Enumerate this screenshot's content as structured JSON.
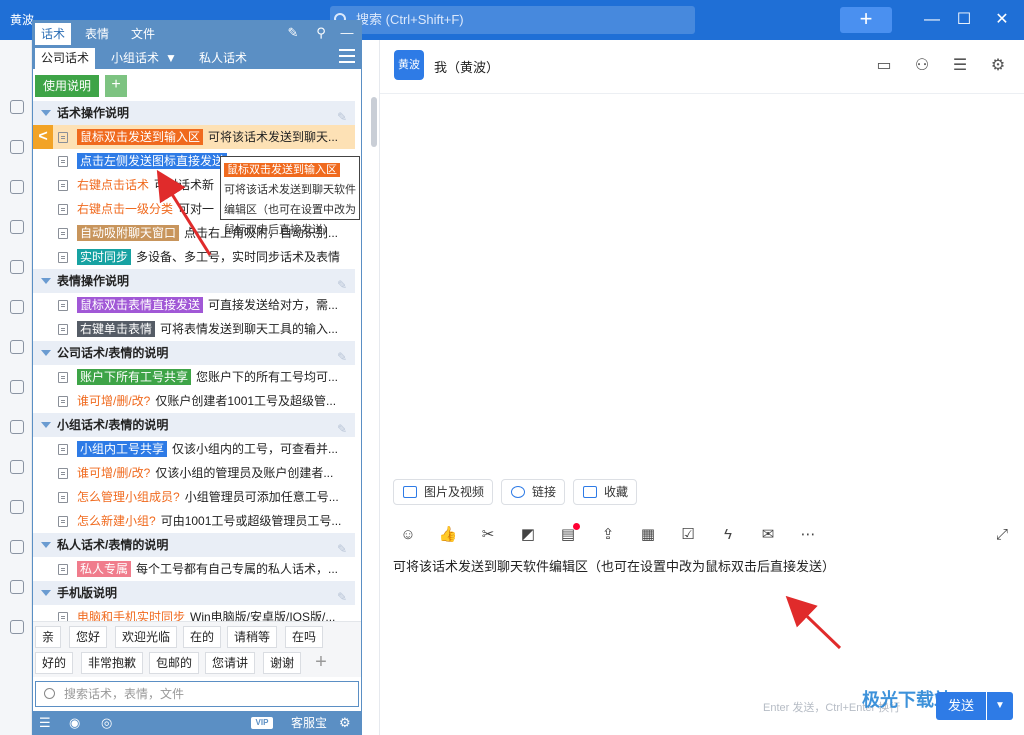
{
  "topbar": {
    "app_badge": "黄波",
    "search_placeholder": "搜索 (Ctrl+Shift+F)",
    "new_label": "+",
    "minimize": "—",
    "maximize": "☐",
    "close": "✕"
  },
  "panel": {
    "tabs": [
      "话术",
      "表情",
      "文件"
    ],
    "subtabs": [
      "公司话术",
      "小组话术",
      "私人话术"
    ],
    "usage_button": "使用说明",
    "add_button": "+",
    "groups": [
      {
        "title": "话术操作说明",
        "rows": [
          {
            "tag": "鼠标双击发送到输入区",
            "color": "#f06a1e",
            "desc": "可将该话术发送到聊天..."
          },
          {
            "tag": "点击左侧发送图标直接发送",
            "color": "#2e7be6",
            "desc": ""
          },
          {
            "tag": "右键点击话术",
            "color": "",
            "desc": "可对话术新"
          },
          {
            "tag": "右键点击一级分类",
            "color": "",
            "desc": "可对一"
          },
          {
            "tag": "自动吸附聊天窗口",
            "color": "#c8955c",
            "desc": "点击右上角吸附，自动识别..."
          },
          {
            "tag": "实时同步",
            "color": "#17a2a2",
            "desc": "多设备、多工号，实时同步话术及表情"
          }
        ]
      },
      {
        "title": "表情操作说明",
        "rows": [
          {
            "tag": "鼠标双击表情直接发送",
            "color": "#a158d6",
            "desc": "可直接发送给对方，需..."
          },
          {
            "tag": "右键单击表情",
            "color": "#555c66",
            "desc": "可将表情发送到聊天工具的输入..."
          }
        ]
      },
      {
        "title": "公司话术/表情的说明",
        "rows": [
          {
            "tag": "账户下所有工号共享",
            "color": "#3ea447",
            "desc": "您账户下的所有工号均可..."
          },
          {
            "tag": "谁可增/删/改?",
            "color": "",
            "desc": "仅账户创建者1001工号及超级管..."
          }
        ]
      },
      {
        "title": "小组话术/表情的说明",
        "rows": [
          {
            "tag": "小组内工号共享",
            "color": "#2e7be6",
            "desc": "仅该小组内的工号，可查看并..."
          },
          {
            "tag": "谁可增/删/改?",
            "color": "",
            "desc": "仅该小组的管理员及账户创建者..."
          },
          {
            "tag": "怎么管理小组成员?",
            "color": "",
            "desc": "小组管理员可添加任意工号..."
          },
          {
            "tag": "怎么新建小组?",
            "color": "",
            "desc": "可由1001工号或超级管理员工号..."
          }
        ]
      },
      {
        "title": "私人话术/表情的说明",
        "rows": [
          {
            "tag": "私人专属",
            "color": "#f07c8c",
            "desc": "每个工号都有自己专属的私人话术，..."
          }
        ]
      },
      {
        "title": "手机版说明",
        "rows": [
          {
            "tag": "电脑和手机实时同步",
            "color": "",
            "desc": "Win电脑版/安卓版/IOS版/..."
          }
        ]
      }
    ],
    "phrases_row1": [
      "亲",
      "您好",
      "欢迎光临",
      "在的",
      "请稍等",
      "在吗"
    ],
    "phrases_row2": [
      "好的",
      "非常抱歉",
      "包邮的",
      "您请讲",
      "谢谢"
    ],
    "search_placeholder": "搜索话术，表情，文件",
    "bottom": {
      "vip": "VIP",
      "service": "客服宝"
    }
  },
  "tooltip": {
    "title": "鼠标双击发送到输入区",
    "body": "可将该话术发送到聊天软件编辑区（也可在设置中改为鼠标双击后直接发送）"
  },
  "chat": {
    "avatar": "黄波",
    "name": "我（黄波）",
    "quick_buttons": [
      "图片及视频",
      "链接",
      "收藏"
    ],
    "input_text": "可将该话术发送到聊天软件编辑区（也可在设置中改为鼠标双击后直接发送）",
    "hint": "Enter 发送，Ctrl+Enter 换行",
    "send_label": "发送",
    "watermark": "极光下载站"
  }
}
